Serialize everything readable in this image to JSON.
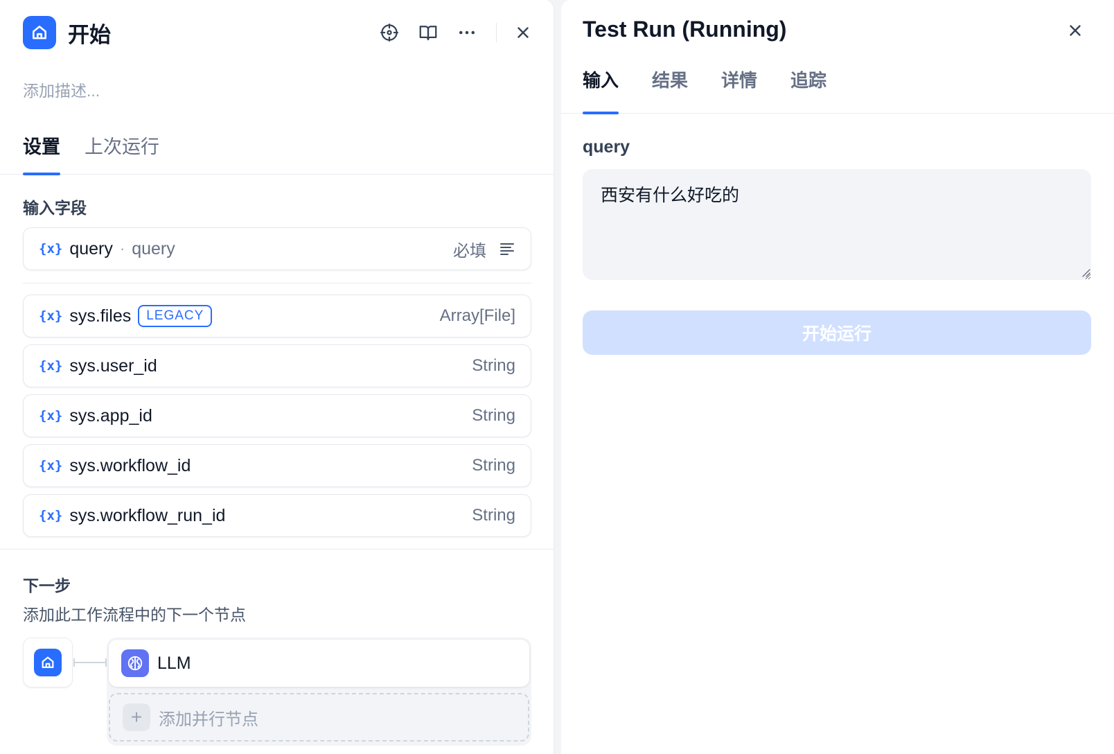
{
  "left_panel": {
    "title": "开始",
    "description_placeholder": "添加描述...",
    "tabs": [
      {
        "label": "设置",
        "active": true
      },
      {
        "label": "上次运行",
        "active": false
      }
    ],
    "input_fields_label": "输入字段",
    "user_inputs": [
      {
        "icon": "{x}",
        "name": "query",
        "label": "query",
        "required_text": "必填"
      }
    ],
    "system_vars": [
      {
        "icon": "{x}",
        "name": "sys.files",
        "badge": "LEGACY",
        "type": "Array[File]"
      },
      {
        "icon": "{x}",
        "name": "sys.user_id",
        "type": "String"
      },
      {
        "icon": "{x}",
        "name": "sys.app_id",
        "type": "String"
      },
      {
        "icon": "{x}",
        "name": "sys.workflow_id",
        "type": "String"
      },
      {
        "icon": "{x}",
        "name": "sys.workflow_run_id",
        "type": "String"
      }
    ],
    "next_step": {
      "title": "下一步",
      "subtitle": "添加此工作流程中的下一个节点",
      "next_node_label": "LLM",
      "add_parallel_label": "添加并行节点",
      "add_parallel_icon": "+"
    },
    "icons": {
      "node": "home-icon",
      "actions": [
        "crosshair-icon",
        "book-icon",
        "more-icon",
        "close-icon"
      ],
      "variable": "variable-icon",
      "field_type": "text-lines-icon",
      "llm": "brain-icon"
    }
  },
  "right_panel": {
    "title": "Test Run (Running)",
    "tabs": [
      {
        "label": "输入",
        "active": true
      },
      {
        "label": "结果",
        "active": false
      },
      {
        "label": "详情",
        "active": false
      },
      {
        "label": "追踪",
        "active": false
      }
    ],
    "query_label": "query",
    "query_value": "西安有什么好吃的",
    "run_button_label": "开始运行"
  },
  "colors": {
    "accent": "#296dff",
    "llm_icon": "#6172f3",
    "run_button_disabled": "#d1e0ff",
    "background": "#f2f4f7"
  }
}
